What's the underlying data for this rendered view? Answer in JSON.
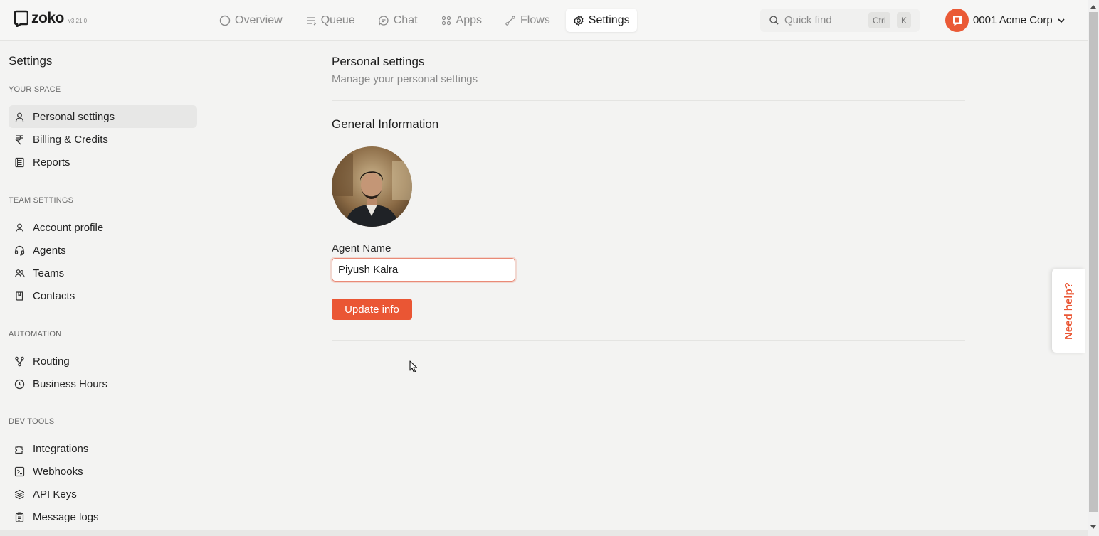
{
  "brand": {
    "name": "zoko",
    "version": "v3.21.0"
  },
  "nav": [
    {
      "label": "Overview",
      "icon": "circle-icon",
      "active": false
    },
    {
      "label": "Queue",
      "icon": "queue-lines-icon",
      "active": false
    },
    {
      "label": "Chat",
      "icon": "chat-bubble-icon",
      "active": false
    },
    {
      "label": "Apps",
      "icon": "grid-dots-icon",
      "active": false
    },
    {
      "label": "Flows",
      "icon": "flow-icon",
      "active": false
    },
    {
      "label": "Settings",
      "icon": "gear-icon",
      "active": true
    }
  ],
  "quickfind": {
    "placeholder": "Quick find",
    "key1": "Ctrl",
    "key2": "K"
  },
  "org": {
    "name": "0001 Acme Corp"
  },
  "sidebar": {
    "title": "Settings",
    "sections": [
      {
        "label": "YOUR SPACE",
        "items": [
          {
            "label": "Personal settings",
            "icon": "user-icon",
            "active": true
          },
          {
            "label": "Billing & Credits",
            "icon": "rupee-icon",
            "active": false
          },
          {
            "label": "Reports",
            "icon": "report-icon",
            "active": false
          }
        ]
      },
      {
        "label": "TEAM SETTINGS",
        "items": [
          {
            "label": "Account profile",
            "icon": "user-icon",
            "active": false
          },
          {
            "label": "Agents",
            "icon": "headset-icon",
            "active": false
          },
          {
            "label": "Teams",
            "icon": "users-icon",
            "active": false
          },
          {
            "label": "Contacts",
            "icon": "book-icon",
            "active": false
          }
        ]
      },
      {
        "label": "AUTOMATION",
        "items": [
          {
            "label": "Routing",
            "icon": "routing-icon",
            "active": false
          },
          {
            "label": "Business Hours",
            "icon": "clock-icon",
            "active": false
          }
        ]
      },
      {
        "label": "DEV TOOLS",
        "items": [
          {
            "label": "Integrations",
            "icon": "puzzle-icon",
            "active": false
          },
          {
            "label": "Webhooks",
            "icon": "terminal-icon",
            "active": false
          },
          {
            "label": "API Keys",
            "icon": "layers-icon",
            "active": false
          },
          {
            "label": "Message logs",
            "icon": "clipboard-icon",
            "active": false
          }
        ]
      }
    ]
  },
  "main": {
    "title": "Personal settings",
    "subtitle": "Manage your personal settings",
    "section_title": "General Information",
    "agent_name_label": "Agent Name",
    "agent_name_value": "Piyush Kalra",
    "update_button": "Update info"
  },
  "help": {
    "label": "Need help?"
  },
  "colors": {
    "accent": "#ea5634",
    "background": "#f3f3f2"
  }
}
